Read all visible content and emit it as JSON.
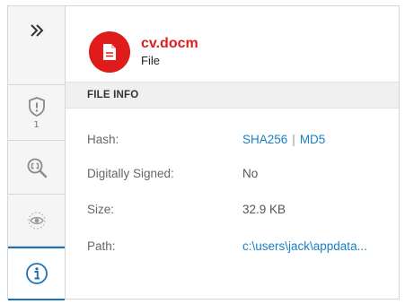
{
  "rail": {
    "expand_icon": "double-chevron-right-icon",
    "alerts": {
      "icon": "shield-alert-icon",
      "count": "1"
    },
    "search_icon": "investigate-search-icon",
    "watch_icon": "eye-icon",
    "info_icon": "info-icon",
    "active": "info"
  },
  "file": {
    "name": "cv.docm",
    "type": "File",
    "badge_color": "#e01b1b",
    "icon": "document-icon"
  },
  "section": {
    "title": "FILE INFO"
  },
  "info": {
    "hash_label": "Hash:",
    "hash_sha256": "SHA256",
    "hash_sep": "|",
    "hash_md5": "MD5",
    "signed_label": "Digitally Signed:",
    "signed_value": "No",
    "size_label": "Size:",
    "size_value": "32.9 KB",
    "path_label": "Path:",
    "path_value": "c:\\users\\jack\\appdata..."
  },
  "colors": {
    "accent": "#1a73b8",
    "link": "#1a7fc4",
    "danger": "#e01b1b"
  }
}
